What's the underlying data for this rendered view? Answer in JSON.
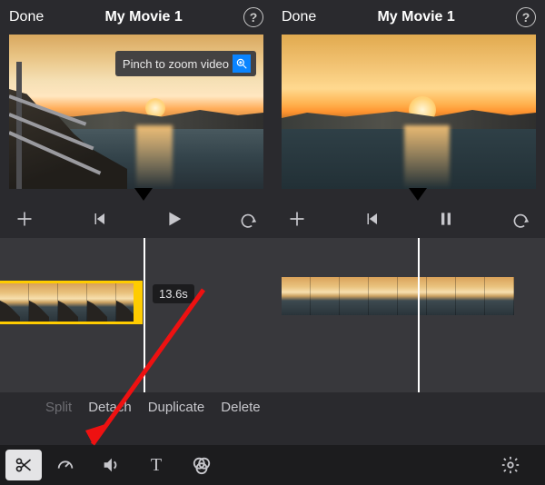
{
  "left": {
    "header": {
      "done": "Done",
      "title": "My Movie 1"
    },
    "hint": "Pinch to zoom video",
    "duration": "13.6s",
    "clip_menu": [
      "Split",
      "Detach",
      "Duplicate",
      "Delete"
    ],
    "icons": {
      "help": "?",
      "add": "add",
      "skip_back": "skip-back",
      "play": "play",
      "undo": "undo",
      "scissors": "scissors",
      "speed": "speed",
      "volume": "volume",
      "text": "T",
      "filters": "filters"
    }
  },
  "right": {
    "header": {
      "done": "Done",
      "title": "My Movie 1"
    },
    "icons": {
      "help": "?",
      "add": "add",
      "skip_back": "skip-back",
      "pause": "pause",
      "undo": "undo",
      "settings": "settings"
    }
  }
}
